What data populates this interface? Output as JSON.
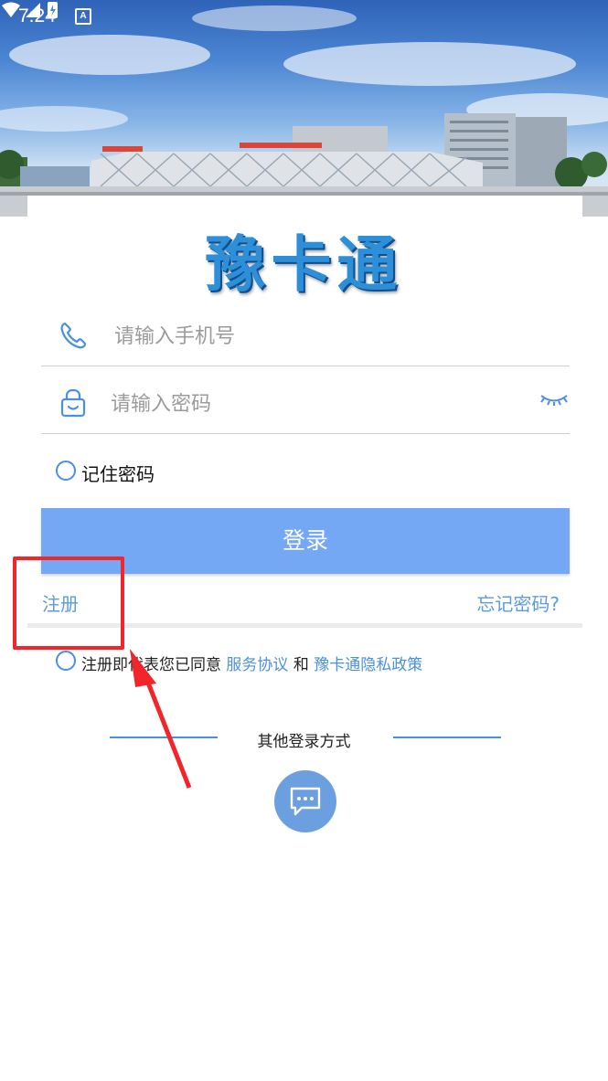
{
  "status_bar": {
    "time": "7:24",
    "notif_icon": "A"
  },
  "logo": {
    "text": "豫卡通"
  },
  "phone_field": {
    "placeholder": "请输入手机号"
  },
  "password_field": {
    "placeholder": "请输入密码"
  },
  "remember": {
    "label": "记住密码"
  },
  "login_button": {
    "label": "登录"
  },
  "links": {
    "register": "注册",
    "forgot": "忘记密码?"
  },
  "agreement": {
    "prefix": "注册即代表您已同意",
    "service": "服务协议",
    "and": "和",
    "privacy": "豫卡通隐私政策"
  },
  "other_login": {
    "label": "其他登录方式"
  },
  "colors": {
    "accent": "#74a8f4",
    "link": "#4a90e2",
    "annotation": "#f2252b"
  }
}
